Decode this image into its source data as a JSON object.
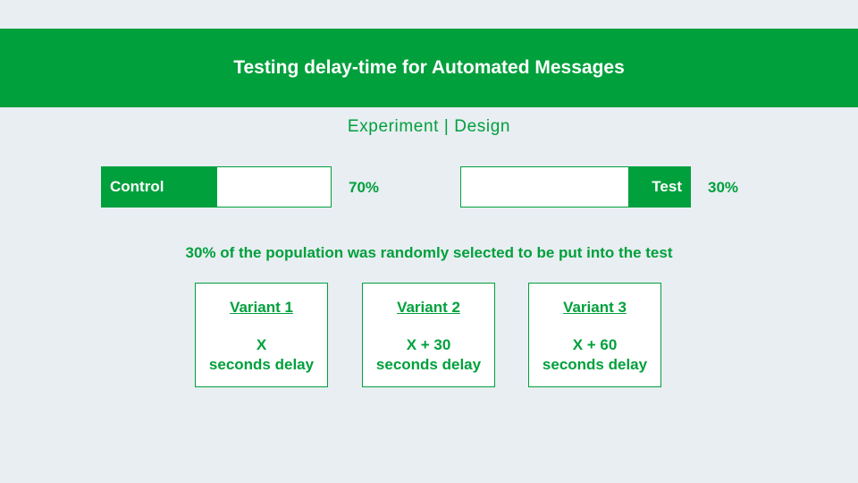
{
  "header": {
    "title": "Testing delay-time for Automated Messages"
  },
  "subtitle": "Experiment | Design",
  "split": {
    "control": {
      "label": "Control",
      "percent_label": "70%",
      "share": 0.7
    },
    "test": {
      "label": "Test",
      "percent_label": "30%",
      "share": 0.3
    }
  },
  "note": "30% of the population was randomly selected to be put into the test",
  "variants": [
    {
      "title": "Variant 1",
      "line1": "X",
      "line2": "seconds delay"
    },
    {
      "title": "Variant 2",
      "line1": "X + 30",
      "line2": "seconds delay"
    },
    {
      "title": "Variant 3",
      "line1": "X + 60",
      "line2": "seconds delay"
    }
  ],
  "colors": {
    "accent": "#00a03c",
    "background": "#e9eef2",
    "panel": "#ffffff"
  }
}
